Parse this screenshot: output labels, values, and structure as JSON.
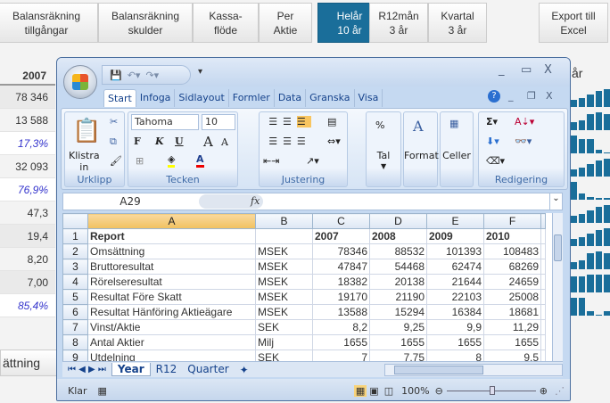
{
  "nav": [
    {
      "label": "Balansräkning\ntillgångar",
      "active": false
    },
    {
      "label": "Balansräkning\nskulder",
      "active": false
    },
    {
      "label": "Kassa-\nflöde",
      "active": false
    },
    {
      "label": "Per\nAktie",
      "active": false
    },
    {
      "label": "Helår\n10 år",
      "active": true
    },
    {
      "label": "R12mån\n3 år",
      "active": false
    },
    {
      "label": "Kvartal\n3 år",
      "active": false
    },
    {
      "label": "Export till\nExcel",
      "active": false
    }
  ],
  "background_table": {
    "col_header": "2007",
    "right_header": "år",
    "values": [
      "78 346",
      "13 588",
      "17,3%",
      "32 093",
      "76,9%",
      "47,3",
      "19,4",
      "8,20",
      "7,00",
      "85,4%"
    ],
    "sparklines": [
      [
        4,
        5,
        7,
        9,
        10
      ],
      [
        4,
        5,
        8,
        9,
        8
      ],
      [
        5,
        4,
        4,
        1,
        0.3
      ],
      [
        4,
        5,
        7,
        9,
        10
      ],
      [
        6,
        2,
        1,
        0.5,
        0.5
      ],
      [
        4,
        5,
        7,
        9,
        10
      ],
      [
        4,
        5,
        7,
        9,
        10
      ],
      [
        4,
        5,
        9,
        10,
        9
      ],
      [
        8,
        8,
        9,
        9,
        9
      ],
      [
        8,
        8,
        2,
        0.5,
        2
      ]
    ]
  },
  "bottom_button": "ättning",
  "excel": {
    "tabs": [
      "Start",
      "Infoga",
      "Sidlayout",
      "Formler",
      "Data",
      "Granska",
      "Visa"
    ],
    "font": "Tahoma",
    "font_size": "10",
    "groups": {
      "clipboard": "Urklipp",
      "paste": "Klistra\nin",
      "font": "Tecken",
      "align": "Justering",
      "number": "Tal",
      "format": "Format",
      "cells": "Celler",
      "edit": "Redigering"
    },
    "font_buttons": [
      "F",
      "K",
      "U"
    ],
    "name_box": "A29",
    "fx": "fx",
    "columns": [
      "A",
      "B",
      "C",
      "D",
      "E",
      "F"
    ],
    "rows": [
      [
        "Report",
        "",
        "2007",
        "2008",
        "2009",
        "2010"
      ],
      [
        "Omsättning",
        "MSEK",
        "78346",
        "88532",
        "101393",
        "108483"
      ],
      [
        "Bruttoresultat",
        "MSEK",
        "47847",
        "54468",
        "62474",
        "68269"
      ],
      [
        "Rörelseresultat",
        "MSEK",
        "18382",
        "20138",
        "21644",
        "24659"
      ],
      [
        "Resultat Före Skatt",
        "MSEK",
        "19170",
        "21190",
        "22103",
        "25008"
      ],
      [
        "Resultat Hänföring Aktieägare",
        "MSEK",
        "13588",
        "15294",
        "16384",
        "18681"
      ],
      [
        "Vinst/Aktie",
        "SEK",
        "8,2",
        "9,25",
        "9,9",
        "11,29"
      ],
      [
        "Antal Aktier",
        "Milj",
        "1655",
        "1655",
        "1655",
        "1655"
      ],
      [
        "Utdelning",
        "SEK",
        "7",
        "7,75",
        "8",
        "9,5"
      ]
    ],
    "sheets": [
      "Year",
      "R12",
      "Quarter"
    ],
    "status": "Klar",
    "zoom": "100%"
  }
}
